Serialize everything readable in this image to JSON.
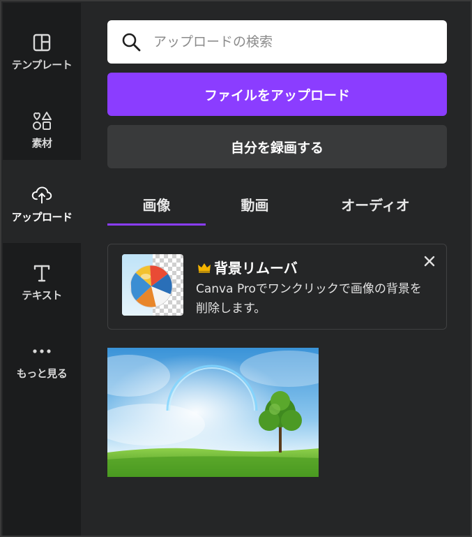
{
  "sidebar": {
    "items": [
      {
        "label": "テンプレート",
        "icon": "template-icon"
      },
      {
        "label": "素材",
        "icon": "elements-icon"
      },
      {
        "label": "アップロード",
        "icon": "upload-cloud-icon",
        "active": true
      },
      {
        "label": "テキスト",
        "icon": "text-icon"
      },
      {
        "label": "もっと見る",
        "icon": "more-dots-icon"
      }
    ]
  },
  "search": {
    "placeholder": "アップロードの検索",
    "value": ""
  },
  "actions": {
    "upload_label": "ファイルをアップロード",
    "record_label": "自分を録画する"
  },
  "tabs": [
    {
      "label": "画像",
      "active": true
    },
    {
      "label": "動画"
    },
    {
      "label": "オーディオ"
    }
  ],
  "promo": {
    "title": "背景リムーバ",
    "description": "Canva Proでワンクリックで画像の背景を削除します。",
    "crown_color": "#f5b400"
  },
  "colors": {
    "accent": "#8b3dff",
    "sidebar_bg": "#1b1c1d",
    "panel_bg": "#252627",
    "secondary_button": "#393a3b"
  }
}
